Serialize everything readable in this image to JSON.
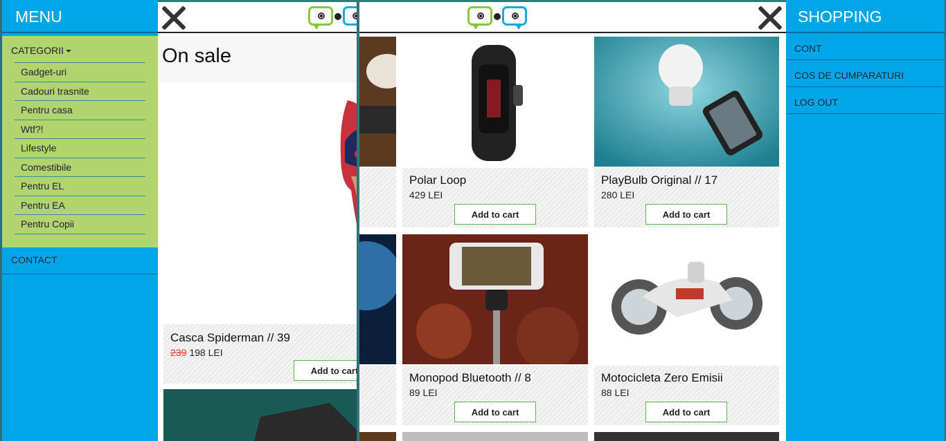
{
  "left_menu": {
    "title": "MENU",
    "categories_label": "CATEGORII",
    "categories": [
      "Gadget-uri",
      "Cadouri trasnite",
      "Pentru casa",
      "Wtf?!",
      "Lifestyle",
      "Comestibile",
      "Pentru EL",
      "Pentru EA",
      "Pentru Copii"
    ],
    "contact_label": "CONTACT"
  },
  "middle_panel": {
    "section_title": "On sale",
    "product": {
      "name": "Casca Spiderman // 39",
      "old_price": "239",
      "price": "198 LEI",
      "button": "Add to cart"
    }
  },
  "shop_panel": {
    "products": [
      {
        "name": "Polar Loop",
        "price": "429 LEI",
        "button": "Add to cart",
        "image": "fitness-band-photo"
      },
      {
        "name": "PlayBulb Original // 17",
        "price": "280 LEI",
        "button": "Add to cart",
        "image": "smart-bulb-photo"
      },
      {
        "name": "Monopod Bluetooth // 8",
        "price": "89 LEI",
        "button": "Add to cart",
        "image": "selfie-stick-photo"
      },
      {
        "name": "Motocicleta Zero Emisii",
        "price": "88 LEI",
        "button": "Add to cart",
        "image": "toy-motorcycle-photo"
      }
    ]
  },
  "right_menu": {
    "title": "SHOPPING",
    "items": [
      "CONT",
      "COS DE CUMPARATURI",
      "LOG OUT"
    ]
  },
  "colors": {
    "menu_blue": "#00a6e8",
    "category_green": "#b2d46e",
    "logo_green": "#8cc63f",
    "logo_blue": "#1aa8e4",
    "button_border": "#57b847",
    "old_price_red": "#e53935"
  }
}
